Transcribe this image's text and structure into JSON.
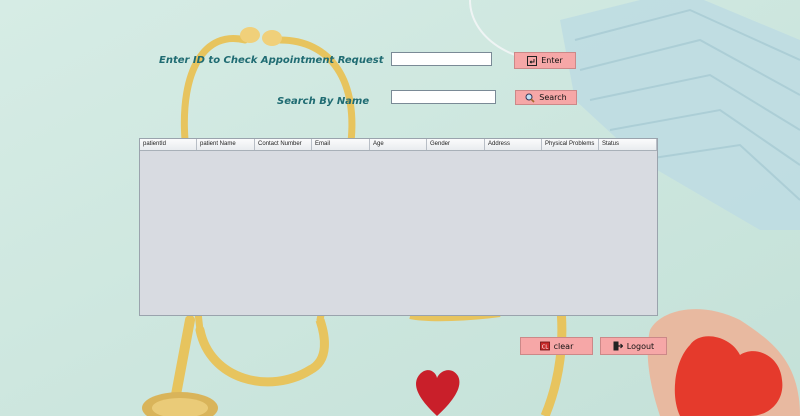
{
  "form": {
    "id_label": "Enter ID to Check  Appointment  Request",
    "id_value": "",
    "enter_label": "Enter",
    "name_label": "Search By Name",
    "name_value": "",
    "search_label": "Search"
  },
  "table": {
    "columns": [
      "patientId",
      "patient Name",
      "Contact Number",
      "Email",
      "Age",
      "Gender",
      "Address",
      "Physical Problems",
      "Status"
    ],
    "rows": []
  },
  "actions": {
    "clear_label": "clear",
    "logout_label": "Logout"
  },
  "colors": {
    "label_text": "#1f6b72",
    "button_bg": "#f6a7a7",
    "background": "#cfe7df"
  }
}
